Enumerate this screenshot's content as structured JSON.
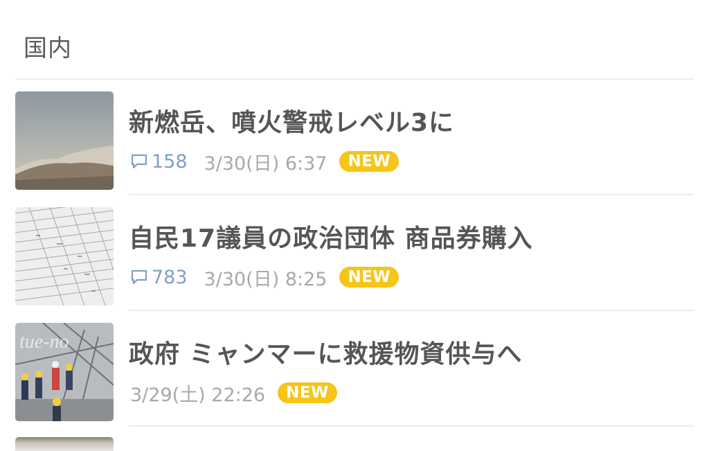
{
  "section": {
    "title": "国内"
  },
  "news": [
    {
      "headline": "新燃岳、噴火警戒レベル3に",
      "comments": "158",
      "timestamp": "3/30(日) 6:37",
      "badge": "NEW",
      "thumbnail": "volcano-photo"
    },
    {
      "headline": "自民17議員の政治団体 商品券購入",
      "comments": "783",
      "timestamp": "3/30(日) 8:25",
      "badge": "NEW",
      "thumbnail": "document-table-photo"
    },
    {
      "headline": "政府 ミャンマーに救援物資供与へ",
      "timestamp": "3/29(土) 22:26",
      "badge": "NEW",
      "thumbnail": "rescue-workers-photo"
    }
  ],
  "colors": {
    "badge": "#f5c518",
    "comment": "#7f9ec8",
    "timestamp": "#a8a8a8",
    "headline": "#555555",
    "divider": "#ececec"
  }
}
